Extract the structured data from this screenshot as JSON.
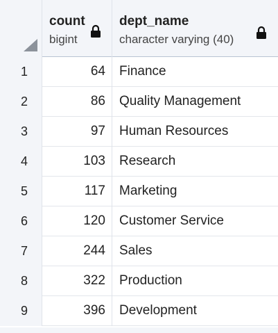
{
  "columns": [
    {
      "name": "count",
      "type": "bigint",
      "locked": true
    },
    {
      "name": "dept_name",
      "type": "character varying (40)",
      "locked": true
    }
  ],
  "rows": [
    {
      "rownum": "1",
      "count": "64",
      "dept_name": "Finance"
    },
    {
      "rownum": "2",
      "count": "86",
      "dept_name": "Quality Management"
    },
    {
      "rownum": "3",
      "count": "97",
      "dept_name": "Human Resources"
    },
    {
      "rownum": "4",
      "count": "103",
      "dept_name": "Research"
    },
    {
      "rownum": "5",
      "count": "117",
      "dept_name": "Marketing"
    },
    {
      "rownum": "6",
      "count": "120",
      "dept_name": "Customer Service"
    },
    {
      "rownum": "7",
      "count": "244",
      "dept_name": "Sales"
    },
    {
      "rownum": "8",
      "count": "322",
      "dept_name": "Production"
    },
    {
      "rownum": "9",
      "count": "396",
      "dept_name": "Development"
    }
  ]
}
